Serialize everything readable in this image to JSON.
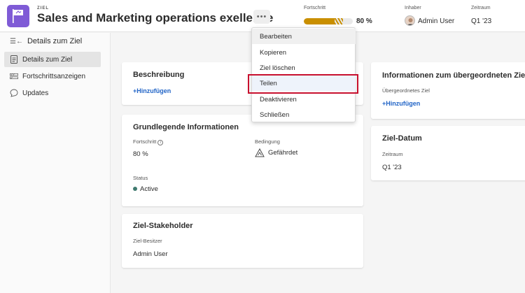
{
  "header": {
    "eyebrow": "ZIEL",
    "title": "Sales and Marketing operations exellence",
    "more": "•••",
    "progress_label": "Fortschritt",
    "progress_value": "80 %",
    "progress_fraction": 0.8,
    "owner_label": "Inhaber",
    "owner_name": "Admin User",
    "period_label": "Zeitraum",
    "period_value": "Q1 '23"
  },
  "sidebar": {
    "heading": "Details zum Ziel",
    "items": [
      {
        "label": "Details zum Ziel",
        "icon": "document-icon"
      },
      {
        "label": "Fortschrittsanzeigen",
        "icon": "progress-bars-icon"
      },
      {
        "label": "Updates",
        "icon": "chat-bubble-icon"
      }
    ]
  },
  "description": {
    "title": "Beschreibung",
    "add": "+Hinzufügen"
  },
  "basic": {
    "title": "Grundlegende Informationen",
    "progress_label": "Fortschritt",
    "progress_value": "80 %",
    "condition_label": "Bedingung",
    "condition_value": "Gefährdet",
    "status_label": "Status",
    "status_value": "Active",
    "status_color": "#3f7a6f"
  },
  "stakeholder": {
    "title": "Ziel-Stakeholder",
    "owner_label": "Ziel-Besitzer",
    "owner_value": "Admin User"
  },
  "parent": {
    "title": "Informationen zum übergeordneten Ziel",
    "label": "Übergeordnetes Ziel",
    "add": "+Hinzufügen"
  },
  "goal_date": {
    "title": "Ziel-Datum",
    "label": "Zeitraum",
    "value": "Q1 '23"
  },
  "menu": {
    "items": [
      "Bearbeiten",
      "Kopieren",
      "Ziel löschen",
      "Teilen",
      "Deaktivieren",
      "Schließen"
    ],
    "highlighted": "Teilen",
    "highlight_color": "#c8102e"
  },
  "colors": {
    "accent_purple": "#7f5bd6",
    "progress_gold": "#c98f00",
    "link_blue": "#1f63c6"
  }
}
